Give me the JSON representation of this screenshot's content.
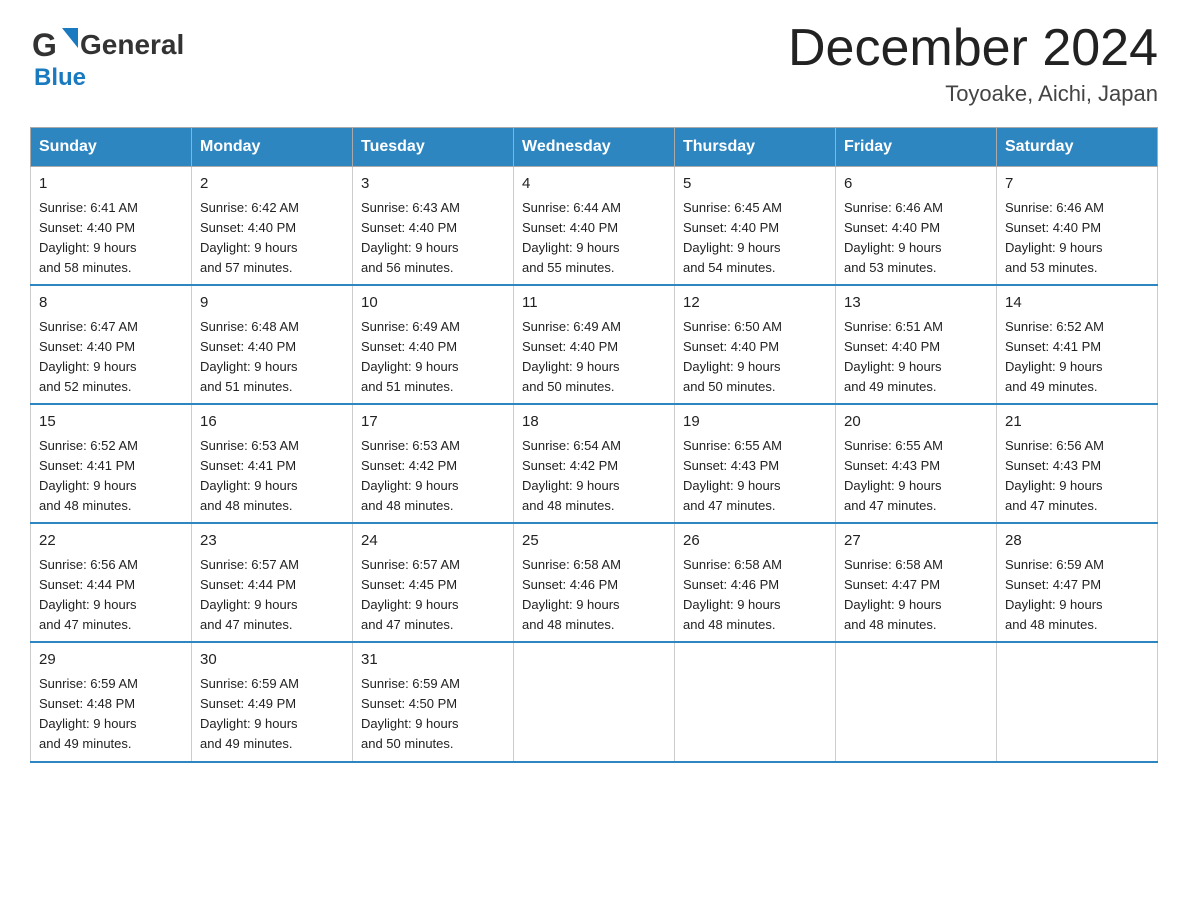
{
  "header": {
    "logo_general": "General",
    "logo_blue": "Blue",
    "month": "December 2024",
    "location": "Toyoake, Aichi, Japan"
  },
  "days_of_week": [
    "Sunday",
    "Monday",
    "Tuesday",
    "Wednesday",
    "Thursday",
    "Friday",
    "Saturday"
  ],
  "weeks": [
    [
      {
        "day": "1",
        "sunrise": "6:41 AM",
        "sunset": "4:40 PM",
        "daylight": "9 hours and 58 minutes."
      },
      {
        "day": "2",
        "sunrise": "6:42 AM",
        "sunset": "4:40 PM",
        "daylight": "9 hours and 57 minutes."
      },
      {
        "day": "3",
        "sunrise": "6:43 AM",
        "sunset": "4:40 PM",
        "daylight": "9 hours and 56 minutes."
      },
      {
        "day": "4",
        "sunrise": "6:44 AM",
        "sunset": "4:40 PM",
        "daylight": "9 hours and 55 minutes."
      },
      {
        "day": "5",
        "sunrise": "6:45 AM",
        "sunset": "4:40 PM",
        "daylight": "9 hours and 54 minutes."
      },
      {
        "day": "6",
        "sunrise": "6:46 AM",
        "sunset": "4:40 PM",
        "daylight": "9 hours and 53 minutes."
      },
      {
        "day": "7",
        "sunrise": "6:46 AM",
        "sunset": "4:40 PM",
        "daylight": "9 hours and 53 minutes."
      }
    ],
    [
      {
        "day": "8",
        "sunrise": "6:47 AM",
        "sunset": "4:40 PM",
        "daylight": "9 hours and 52 minutes."
      },
      {
        "day": "9",
        "sunrise": "6:48 AM",
        "sunset": "4:40 PM",
        "daylight": "9 hours and 51 minutes."
      },
      {
        "day": "10",
        "sunrise": "6:49 AM",
        "sunset": "4:40 PM",
        "daylight": "9 hours and 51 minutes."
      },
      {
        "day": "11",
        "sunrise": "6:49 AM",
        "sunset": "4:40 PM",
        "daylight": "9 hours and 50 minutes."
      },
      {
        "day": "12",
        "sunrise": "6:50 AM",
        "sunset": "4:40 PM",
        "daylight": "9 hours and 50 minutes."
      },
      {
        "day": "13",
        "sunrise": "6:51 AM",
        "sunset": "4:40 PM",
        "daylight": "9 hours and 49 minutes."
      },
      {
        "day": "14",
        "sunrise": "6:52 AM",
        "sunset": "4:41 PM",
        "daylight": "9 hours and 49 minutes."
      }
    ],
    [
      {
        "day": "15",
        "sunrise": "6:52 AM",
        "sunset": "4:41 PM",
        "daylight": "9 hours and 48 minutes."
      },
      {
        "day": "16",
        "sunrise": "6:53 AM",
        "sunset": "4:41 PM",
        "daylight": "9 hours and 48 minutes."
      },
      {
        "day": "17",
        "sunrise": "6:53 AM",
        "sunset": "4:42 PM",
        "daylight": "9 hours and 48 minutes."
      },
      {
        "day": "18",
        "sunrise": "6:54 AM",
        "sunset": "4:42 PM",
        "daylight": "9 hours and 48 minutes."
      },
      {
        "day": "19",
        "sunrise": "6:55 AM",
        "sunset": "4:43 PM",
        "daylight": "9 hours and 47 minutes."
      },
      {
        "day": "20",
        "sunrise": "6:55 AM",
        "sunset": "4:43 PM",
        "daylight": "9 hours and 47 minutes."
      },
      {
        "day": "21",
        "sunrise": "6:56 AM",
        "sunset": "4:43 PM",
        "daylight": "9 hours and 47 minutes."
      }
    ],
    [
      {
        "day": "22",
        "sunrise": "6:56 AM",
        "sunset": "4:44 PM",
        "daylight": "9 hours and 47 minutes."
      },
      {
        "day": "23",
        "sunrise": "6:57 AM",
        "sunset": "4:44 PM",
        "daylight": "9 hours and 47 minutes."
      },
      {
        "day": "24",
        "sunrise": "6:57 AM",
        "sunset": "4:45 PM",
        "daylight": "9 hours and 47 minutes."
      },
      {
        "day": "25",
        "sunrise": "6:58 AM",
        "sunset": "4:46 PM",
        "daylight": "9 hours and 48 minutes."
      },
      {
        "day": "26",
        "sunrise": "6:58 AM",
        "sunset": "4:46 PM",
        "daylight": "9 hours and 48 minutes."
      },
      {
        "day": "27",
        "sunrise": "6:58 AM",
        "sunset": "4:47 PM",
        "daylight": "9 hours and 48 minutes."
      },
      {
        "day": "28",
        "sunrise": "6:59 AM",
        "sunset": "4:47 PM",
        "daylight": "9 hours and 48 minutes."
      }
    ],
    [
      {
        "day": "29",
        "sunrise": "6:59 AM",
        "sunset": "4:48 PM",
        "daylight": "9 hours and 49 minutes."
      },
      {
        "day": "30",
        "sunrise": "6:59 AM",
        "sunset": "4:49 PM",
        "daylight": "9 hours and 49 minutes."
      },
      {
        "day": "31",
        "sunrise": "6:59 AM",
        "sunset": "4:50 PM",
        "daylight": "9 hours and 50 minutes."
      },
      null,
      null,
      null,
      null
    ]
  ],
  "labels": {
    "sunrise": "Sunrise:",
    "sunset": "Sunset:",
    "daylight": "Daylight:"
  }
}
